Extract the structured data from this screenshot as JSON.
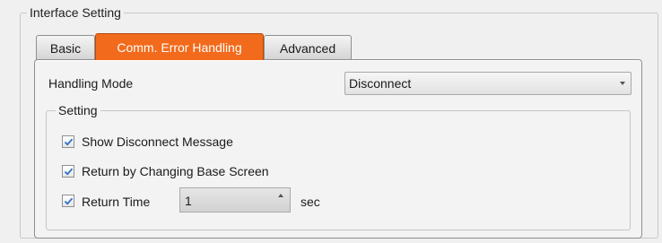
{
  "group": {
    "title": "Interface Setting"
  },
  "tabs": [
    {
      "label": "Basic",
      "active": false
    },
    {
      "label": "Comm. Error Handling",
      "active": true
    },
    {
      "label": "Advanced",
      "active": false
    }
  ],
  "handling_mode": {
    "label": "Handling Mode",
    "value": "Disconnect"
  },
  "setting": {
    "title": "Setting",
    "options": [
      {
        "label": "Show Disconnect Message",
        "checked": true
      },
      {
        "label": "Return by Changing Base Screen",
        "checked": true
      },
      {
        "label": "Return Time",
        "checked": true
      }
    ],
    "return_time": {
      "value": "1",
      "unit": "sec"
    }
  },
  "colors": {
    "active_tab": "#f26a1b",
    "check": "#2a6fc9"
  }
}
